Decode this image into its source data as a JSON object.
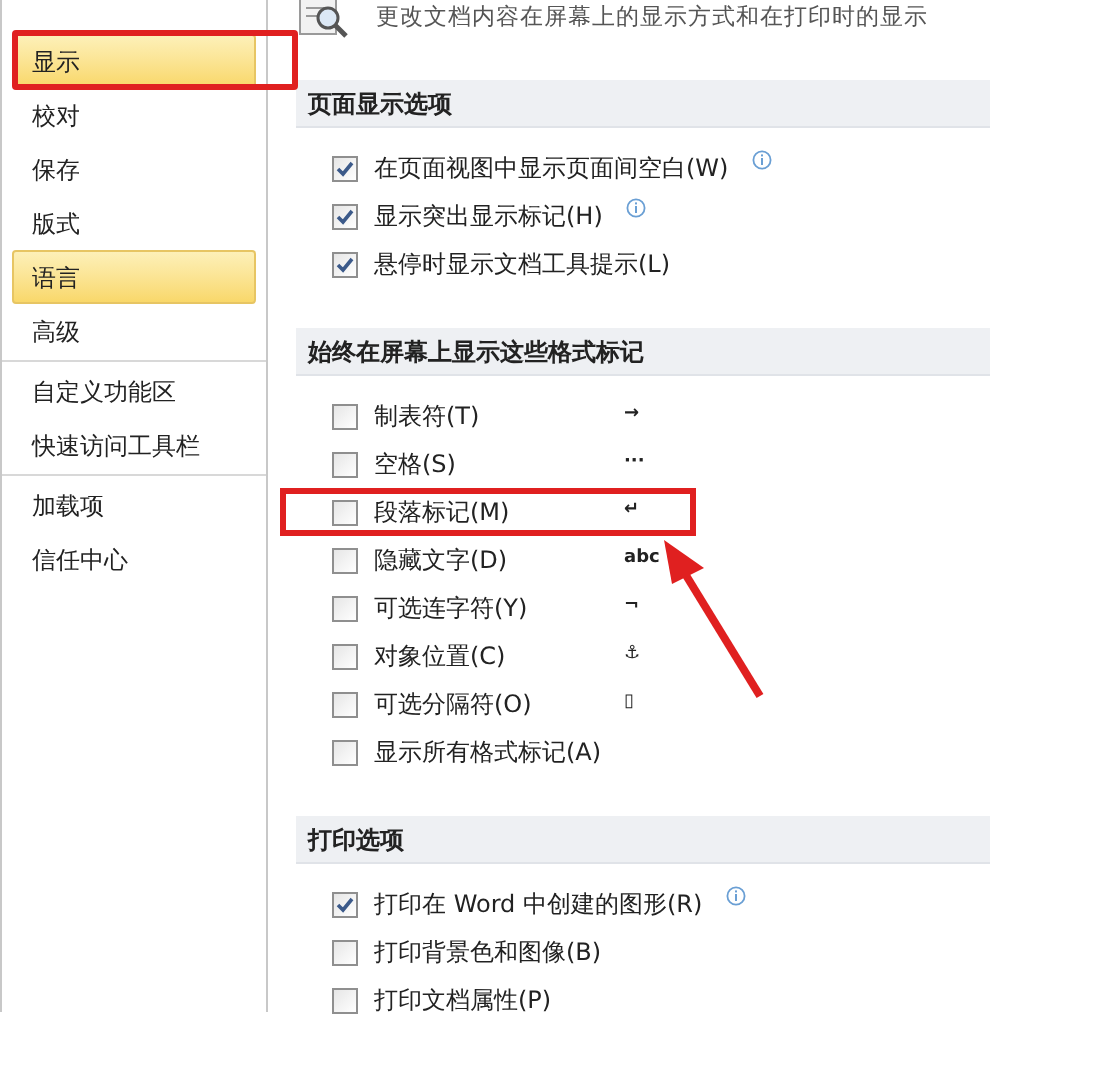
{
  "sidebar": {
    "groups": [
      [
        {
          "label": "显示",
          "selected": true
        },
        {
          "label": "校对",
          "selected": false
        },
        {
          "label": "保存",
          "selected": false
        },
        {
          "label": "版式",
          "selected": false
        },
        {
          "label": "语言",
          "selected": true
        },
        {
          "label": "高级",
          "selected": false
        }
      ],
      [
        {
          "label": "自定义功能区",
          "selected": false
        },
        {
          "label": "快速访问工具栏",
          "selected": false
        }
      ],
      [
        {
          "label": "加载项",
          "selected": false
        },
        {
          "label": "信任中心",
          "selected": false
        }
      ]
    ]
  },
  "description": "更改文档内容在屏幕上的显示方式和在打印时的显示",
  "sections": [
    {
      "title": "页面显示选项",
      "options": [
        {
          "label": "在页面视图中显示页面间空白(W)",
          "checked": true,
          "info": true
        },
        {
          "label": "显示突出显示标记(H)",
          "checked": true,
          "info": true
        },
        {
          "label": "悬停时显示文档工具提示(L)",
          "checked": true,
          "info": false
        }
      ]
    },
    {
      "title": "始终在屏幕上显示这些格式标记",
      "options": [
        {
          "label": "制表符(T)",
          "checked": false,
          "info": false,
          "symbol": "→"
        },
        {
          "label": "空格(S)",
          "checked": false,
          "info": false,
          "symbol": "···"
        },
        {
          "label": "段落标记(M)",
          "checked": false,
          "info": false,
          "symbol": "↵",
          "highlighted": true
        },
        {
          "label": "隐藏文字(D)",
          "checked": false,
          "info": false,
          "symbol": "abc"
        },
        {
          "label": "可选连字符(Y)",
          "checked": false,
          "info": false,
          "symbol": "¬"
        },
        {
          "label": "对象位置(C)",
          "checked": false,
          "info": false,
          "symbol": "⚓"
        },
        {
          "label": "可选分隔符(O)",
          "checked": false,
          "info": false,
          "symbol": "▯"
        },
        {
          "label": "显示所有格式标记(A)",
          "checked": false,
          "info": false
        }
      ]
    },
    {
      "title": "打印选项",
      "options": [
        {
          "label": "打印在 Word 中创建的图形(R)",
          "checked": true,
          "info": true
        },
        {
          "label": "打印背景色和图像(B)",
          "checked": false,
          "info": false
        },
        {
          "label": "打印文档属性(P)",
          "checked": false,
          "info": false
        }
      ]
    }
  ]
}
